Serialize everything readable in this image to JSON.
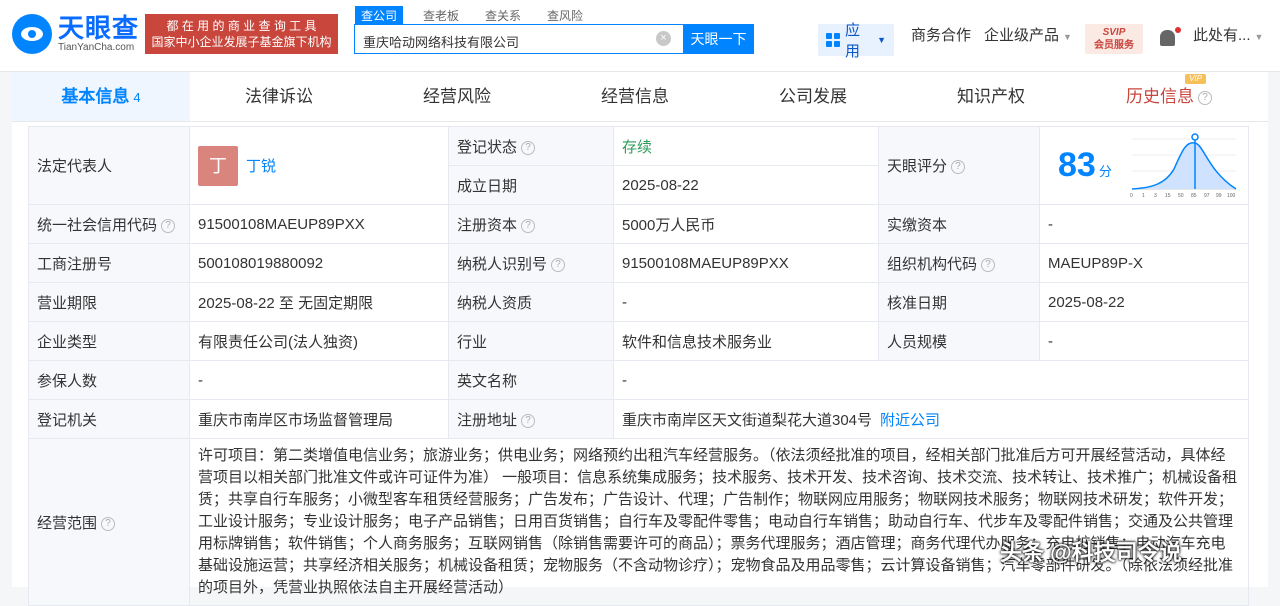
{
  "logo": {
    "cn": "天眼查",
    "en": "TianYanCha.com"
  },
  "slogan": {
    "line1": "都 在 用 的 商 业 查 询 工 具",
    "line2": "国家中小企业发展子基金旗下机构"
  },
  "search": {
    "tabs": [
      "查公司",
      "查老板",
      "查关系",
      "查风险"
    ],
    "value": "重庆哈动网络科技有限公司",
    "button": "天眼一下"
  },
  "nav": {
    "apps": "应用",
    "business": "商务合作",
    "enterprise": "企业级产品",
    "vip_line1": "SVIP",
    "vip_line2": "会员服务",
    "user": "此处有..."
  },
  "tabs": [
    {
      "label": "基本信息",
      "count": "4"
    },
    {
      "label": "法律诉讼"
    },
    {
      "label": "经营风险"
    },
    {
      "label": "经营信息"
    },
    {
      "label": "公司发展"
    },
    {
      "label": "知识产权"
    },
    {
      "label": "历史信息",
      "tag": "VIP"
    }
  ],
  "info": {
    "legal_rep_label": "法定代表人",
    "legal_rep_avatar": "丁",
    "legal_rep_name": "丁锐",
    "status_label": "登记状态",
    "status_value": "存续",
    "established_label": "成立日期",
    "established_value": "2025-08-22",
    "score_label": "天眼评分",
    "score_value": "83",
    "score_unit": "分",
    "score_ticks": [
      "0",
      "1",
      "3",
      "15",
      "50",
      "85",
      "97",
      "99",
      "100"
    ],
    "credit_code_label": "统一社会信用代码",
    "credit_code_value": "91500108MAEUP89PXX",
    "reg_capital_label": "注册资本",
    "reg_capital_value": "5000万人民币",
    "paid_capital_label": "实缴资本",
    "paid_capital_value": "-",
    "biz_reg_label": "工商注册号",
    "biz_reg_value": "500108019880092",
    "taxpayer_id_label": "纳税人识别号",
    "taxpayer_id_value": "91500108MAEUP89PXX",
    "org_code_label": "组织机构代码",
    "org_code_value": "MAEUP89P-X",
    "term_label": "营业期限",
    "term_value": "2025-08-22 至 无固定期限",
    "taxpayer_qual_label": "纳税人资质",
    "taxpayer_qual_value": "-",
    "approve_label": "核准日期",
    "approve_value": "2025-08-22",
    "type_label": "企业类型",
    "type_value": "有限责任公司(法人独资)",
    "industry_label": "行业",
    "industry_value": "软件和信息技术服务业",
    "staff_label": "人员规模",
    "staff_value": "-",
    "insured_label": "参保人数",
    "insured_value": "-",
    "en_name_label": "英文名称",
    "en_name_value": "-",
    "authority_label": "登记机关",
    "authority_value": "重庆市南岸区市场监督管理局",
    "address_label": "注册地址",
    "address_value": "重庆市南岸区天文街道梨花大道304号",
    "nearby_link": "附近公司",
    "scope_label": "经营范围",
    "scope_value": "许可项目：第二类增值电信业务；旅游业务；供电业务；网络预约出租汽车经营服务。（依法须经批准的项目，经相关部门批准后方可开展经营活动，具体经营项目以相关部门批准文件或许可证件为准） 一般项目：信息系统集成服务；技术服务、技术开发、技术咨询、技术交流、技术转让、技术推广；机械设备租赁；共享自行车服务；小微型客车租赁经营服务；广告发布；广告设计、代理；广告制作；物联网应用服务；物联网技术服务；物联网技术研发；软件开发；工业设计服务；专业设计服务；电子产品销售；日用百货销售；自行车及零配件零售；电动自行车销售；助动自行车、代步车及零配件销售；交通及公共管理用标牌销售；软件销售；个人商务服务；互联网销售（除销售需要许可的商品）；票务代理服务；酒店管理；商务代理代办服务；充电桩销售；电动汽车充电基础设施运营；共享经济相关服务；机械设备租赁；宠物服务（不含动物诊疗）；宠物食品及用品零售；云计算设备销售；汽车零部件研发。（除依法须经批准的项目外，凭营业执照依法自主开展经营活动）"
  },
  "watermark": "头条 @科技司令说"
}
